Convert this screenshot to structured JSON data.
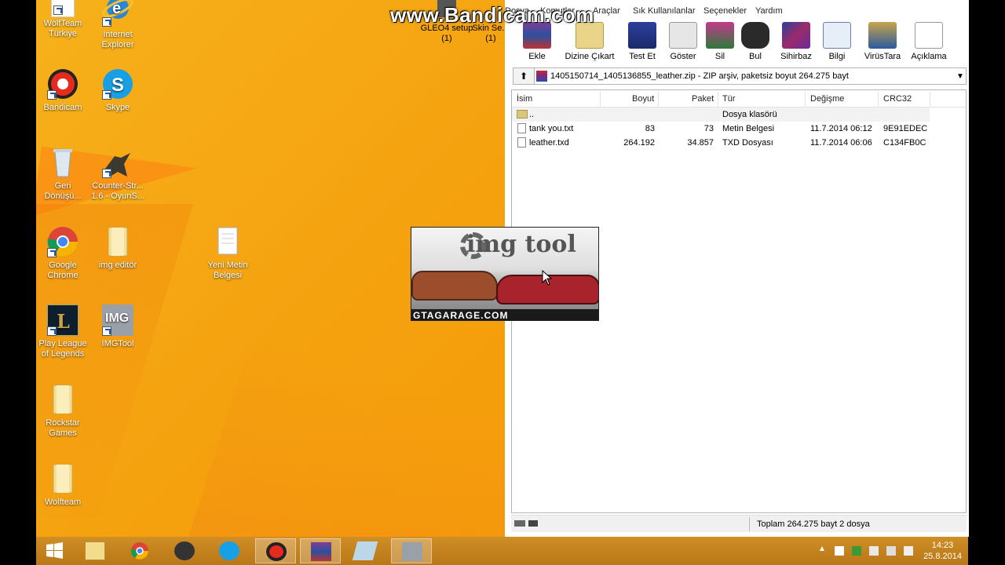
{
  "watermark": "www.Bandicam.com",
  "desktop": {
    "icons": [
      {
        "label": "WolfTeam Türkiye",
        "icon": "wolfteam-icon"
      },
      {
        "label": "Internet Explorer",
        "icon": "internet-explorer-icon"
      },
      {
        "label": "Bandicam",
        "icon": "bandicam-icon"
      },
      {
        "label": "Skype",
        "icon": "skype-icon"
      },
      {
        "label": "Geri Dönüşü...",
        "icon": "recycle-bin-icon"
      },
      {
        "label": "Counter-Str... 1.6 - OyunS...",
        "icon": "counter-strike-icon"
      },
      {
        "label": "Google Chrome",
        "icon": "chrome-icon"
      },
      {
        "label": "img editör",
        "icon": "folder-icon"
      },
      {
        "label": "Yeni Metin Belgesi",
        "icon": "text-document-icon"
      },
      {
        "label": "Play League of Legends",
        "icon": "league-of-legends-icon"
      },
      {
        "label": "IMGTool",
        "icon": "imgtool-icon"
      },
      {
        "label": "Rockstar Games",
        "icon": "folder-icon"
      },
      {
        "label": "Wolfteam",
        "icon": "folder-icon"
      }
    ],
    "partial_icons": [
      {
        "label": "GLEO4 setup (1)"
      },
      {
        "label": "Skin Se... (1)"
      }
    ]
  },
  "winrar": {
    "menu": [
      "Dosya",
      "Komutlar",
      "Araçlar",
      "Sık Kullanılanlar",
      "Seçenekler",
      "Yardım"
    ],
    "toolbar": [
      {
        "label": "Ekle",
        "icon": "add-archive-icon"
      },
      {
        "label": "Dizine Çıkart",
        "icon": "extract-to-icon"
      },
      {
        "label": "Test Et",
        "icon": "test-icon"
      },
      {
        "label": "Göster",
        "icon": "view-icon"
      },
      {
        "label": "Sil",
        "icon": "delete-icon"
      },
      {
        "label": "Bul",
        "icon": "find-icon"
      },
      {
        "label": "Sihirbaz",
        "icon": "wizard-icon"
      },
      {
        "label": "Bilgi",
        "icon": "info-icon"
      },
      {
        "label": "VirüsTara",
        "icon": "virus-scan-icon"
      },
      {
        "label": "Açıklama",
        "icon": "comment-icon"
      }
    ],
    "path": "1405150714_1405136855_leather.zip - ZIP arşiv, paketsiz boyut 264.275 bayt",
    "columns": [
      "İsim",
      "Boyut",
      "Paket",
      "Tür",
      "Değişme",
      "CRC32"
    ],
    "rows": [
      {
        "name": "..",
        "size": "",
        "packed": "",
        "type": "Dosya klasörü",
        "modified": "",
        "crc": ""
      },
      {
        "name": "tank you.txt",
        "size": "83",
        "packed": "73",
        "type": "Metin Belgesi",
        "modified": "11.7.2014 06:12",
        "crc": "9E91EDEC"
      },
      {
        "name": "leather.txd",
        "size": "264.192",
        "packed": "34.857",
        "type": "TXD Dosyası",
        "modified": "11.7.2014 06:06",
        "crc": "C134FB0C"
      }
    ],
    "status": "Toplam 264.275 bayt 2 dosya"
  },
  "preview": {
    "title": "img tool",
    "footer": "GTAGARAGE.COM"
  },
  "taskbar": {
    "apps": [
      "file-explorer-icon",
      "chrome-icon",
      "steam-icon",
      "skype-icon",
      "bandicam-icon",
      "winrar-icon",
      "notepad-icon",
      "imgtool-icon"
    ],
    "clock_time": "14:23",
    "clock_date": "25.8.2014"
  },
  "colors": {
    "desktop_bg": "#f5a20f",
    "taskbar": "#c98a20",
    "selection": "#cce8ff"
  }
}
